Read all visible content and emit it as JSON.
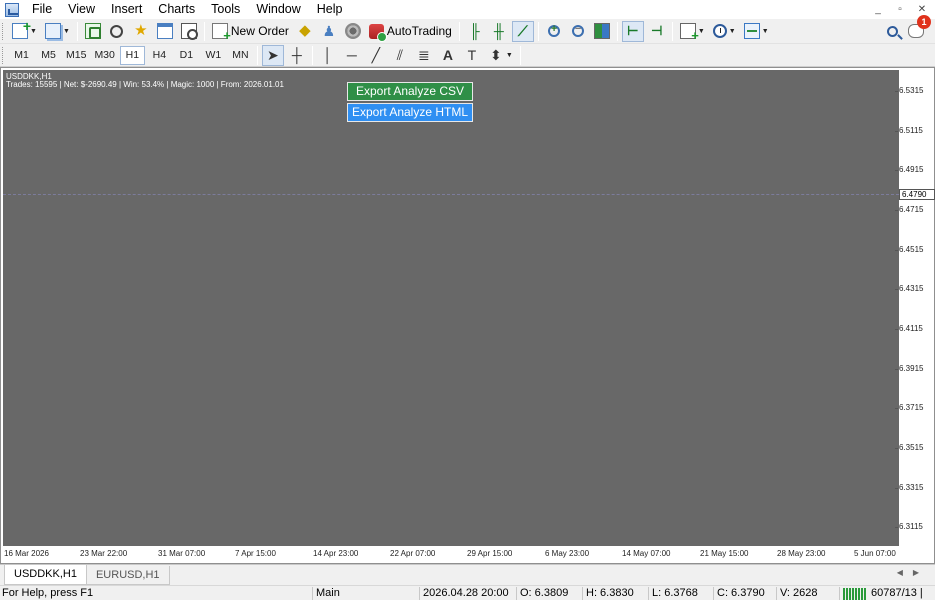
{
  "menu": {
    "items": [
      "File",
      "View",
      "Insert",
      "Charts",
      "Tools",
      "Window",
      "Help"
    ]
  },
  "window_controls": {
    "minimize": "_",
    "restore": "▫",
    "close": "✕"
  },
  "toolbar": {
    "new_order_label": "New Order",
    "autotrading_label": "AutoTrading",
    "notifications_count": "1"
  },
  "timeframes": [
    "M1",
    "M5",
    "M15",
    "M30",
    "H1",
    "H4",
    "D1",
    "W1",
    "MN"
  ],
  "active_timeframe": "H1",
  "chart": {
    "title": "USDDKK,H1",
    "stats": "Trades: 15595 | Net: $-2690.49 | Win: 53.4% | Magic: 1000 | From: 2026.01.01",
    "export_csv_label": "Export Analyze CSV",
    "export_html_label": "Export Analyze HTML",
    "current_price": "6.4790",
    "background_color": "#686868",
    "csv_button_color": "#2f8f47",
    "html_button_color": "#2f8ff2"
  },
  "chart_data": {
    "type": "line",
    "title": "USDDKK,H1",
    "price_ticks": [
      "6.5315",
      "6.5115",
      "6.4915",
      "6.4715",
      "6.4515",
      "6.4315",
      "6.4115",
      "6.3915",
      "6.3715",
      "6.3515",
      "6.3315",
      "6.3115"
    ],
    "time_ticks": [
      "16 Mar 2026",
      "23 Mar 22:00",
      "31 Mar 07:00",
      "7 Apr 15:00",
      "14 Apr 23:00",
      "22 Apr 07:00",
      "29 Apr 15:00",
      "6 May 23:00",
      "14 May 07:00",
      "21 May 15:00",
      "28 May 23:00",
      "5 Jun 07:00"
    ],
    "current_price": 6.479,
    "ylim": [
      6.3035,
      6.5395
    ],
    "series": []
  },
  "tabs": [
    "USDDKK,H1",
    "EURUSD,H1"
  ],
  "status": {
    "help": "For Help, press F1",
    "profile": "Main",
    "datetime": "2026.04.28 20:00",
    "open": "O: 6.3809",
    "high": "H: 6.3830",
    "low": "L: 6.3768",
    "close": "C: 6.3790",
    "volume": "V: 2628",
    "traffic": "60787/13 |"
  }
}
